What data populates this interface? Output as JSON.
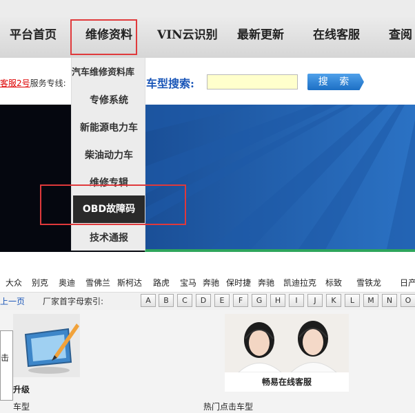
{
  "nav": {
    "items": [
      "平台首页",
      "维修资料",
      "VIN云识别",
      "最新更新",
      "在线客服",
      "查阅"
    ]
  },
  "service": {
    "link": "客服2号",
    "label": "服务专线:"
  },
  "search": {
    "label": "车型搜索:",
    "value": "",
    "button": "搜 索"
  },
  "dropdown": {
    "items": [
      "汽车维修资料库",
      "专修系统",
      "新能源电力车",
      "柴油动力车",
      "维修专辑",
      "OBD故障码",
      "技术通报"
    ]
  },
  "brands": [
    "大众",
    "别克",
    "奥迪",
    "雪佛兰",
    "斯柯达",
    "路虎",
    "宝马",
    "奔驰",
    "保时捷",
    "奔驰",
    "凯迪拉克",
    "标致",
    "雪铁龙",
    "日产"
  ],
  "index": {
    "prev": "上一页",
    "label": "厂家首字母索引:",
    "letters": [
      "A",
      "B",
      "C",
      "D",
      "E",
      "F",
      "G",
      "H",
      "I",
      "J",
      "K",
      "L",
      "M",
      "N",
      "O"
    ]
  },
  "bottom": {
    "left_text": "击",
    "upgrade": "升级",
    "service_caption": "畅易在线客服",
    "hot_left": "车型",
    "hot_right": "热门点击车型"
  },
  "colors": {
    "accent_red": "#e0393b",
    "link_blue": "#1a56b8",
    "search_btn": "#1c6fc4"
  }
}
